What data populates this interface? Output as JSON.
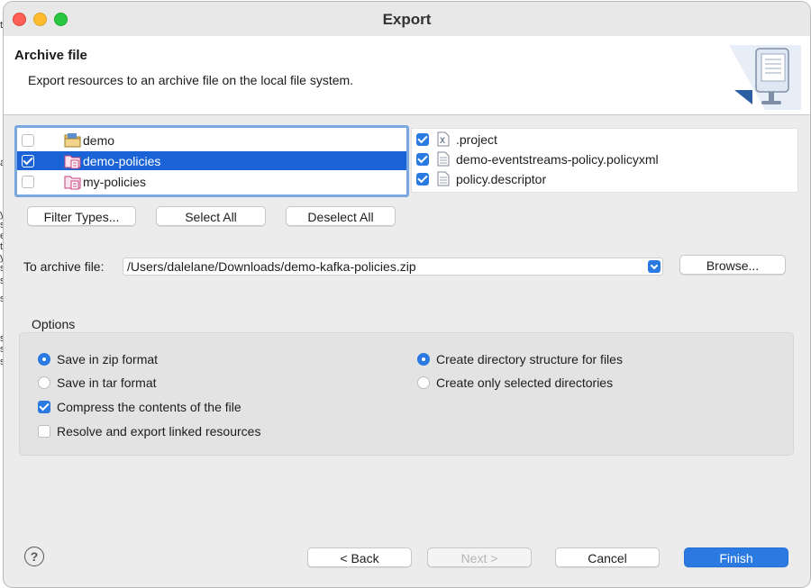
{
  "window": {
    "title": "Export"
  },
  "header": {
    "title": "Archive file",
    "description": "Export resources to an archive file on the local file system.",
    "icon": "export-wizard-icon"
  },
  "tree": {
    "items": [
      {
        "label": "demo",
        "checked": false,
        "selected": false,
        "icon": "project-folder-icon"
      },
      {
        "label": "demo-policies",
        "checked": true,
        "selected": true,
        "icon": "policy-project-icon"
      },
      {
        "label": "my-policies",
        "checked": false,
        "selected": false,
        "icon": "policy-project-icon"
      }
    ]
  },
  "files": {
    "items": [
      {
        "label": ".project",
        "checked": true,
        "icon": "xml-file-icon"
      },
      {
        "label": "demo-eventstreams-policy.policyxml",
        "checked": true,
        "icon": "text-file-icon"
      },
      {
        "label": "policy.descriptor",
        "checked": true,
        "icon": "text-file-icon"
      }
    ]
  },
  "selection_buttons": {
    "filter_types": "Filter Types...",
    "select_all": "Select All",
    "deselect_all": "Deselect All"
  },
  "destination": {
    "label": "To archive file:",
    "value": "/Users/dalelane/Downloads/demo-kafka-policies.zip",
    "browse": "Browse..."
  },
  "options": {
    "title": "Options",
    "save_zip": "Save in zip format",
    "save_tar": "Save in tar format",
    "compress": "Compress the contents of the file",
    "resolve_linked": "Resolve and export linked resources",
    "create_structure": "Create directory structure for files",
    "create_selected": "Create only selected directories",
    "format": "zip",
    "compress_checked": true,
    "resolve_checked": false,
    "structure": "full"
  },
  "footer": {
    "back": "< Back",
    "next": "Next >",
    "cancel": "Cancel",
    "finish": "Finish",
    "help": "?"
  },
  "background_text": [
    "t",
    "a",
    "y",
    "s",
    "e",
    "t",
    "y",
    "s",
    "s",
    "s",
    "s",
    "s",
    "s"
  ],
  "colors": {
    "accent": "#2a7ae2",
    "selection": "#1a63d6",
    "focus_ring": "#7aa7e0"
  }
}
